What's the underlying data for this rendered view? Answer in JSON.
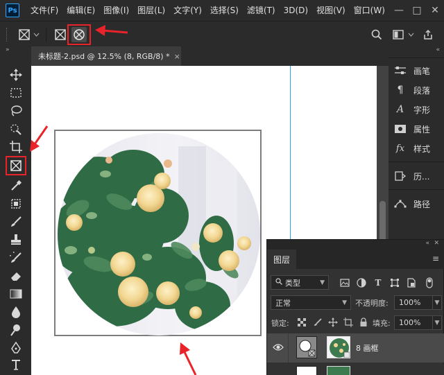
{
  "app": {
    "logo_text": "Ps"
  },
  "menu": {
    "items": [
      "文件(F)",
      "编辑(E)",
      "图像(I)",
      "图层(L)",
      "文字(Y)",
      "选择(S)",
      "滤镜(T)",
      "3D(D)",
      "视图(V)",
      "窗口(W)"
    ]
  },
  "window_controls": {
    "minimize": "—",
    "maximize": "□",
    "close": "✕"
  },
  "document": {
    "tab_title": "未标题-2.psd @ 12.5% (8, RGB/8) *",
    "tab_close": "×"
  },
  "right_dock": {
    "items": [
      {
        "label": "画笔",
        "icon": "brush-settings-icon"
      },
      {
        "label": "段落",
        "icon": "paragraph-icon"
      },
      {
        "label": "字形",
        "icon": "glyphs-icon"
      },
      {
        "label": "属性",
        "icon": "properties-icon"
      },
      {
        "label": "样式",
        "icon": "styles-icon"
      },
      {
        "label": "历...",
        "icon": "history-icon"
      },
      {
        "label": "路径",
        "icon": "paths-icon"
      }
    ]
  },
  "layers_panel": {
    "tab_label": "图层",
    "filter_kind": "类型",
    "blend_mode": "正常",
    "opacity_label": "不透明度:",
    "opacity_value": "100%",
    "lock_label": "锁定:",
    "fill_label": "填充:",
    "fill_value": "100%",
    "layers": [
      {
        "name": "8 画框"
      }
    ]
  },
  "colors": {
    "ui_dark": "#2b2b2b",
    "highlight_red": "#e8232a",
    "guide_blue": "#2ea3ef"
  }
}
